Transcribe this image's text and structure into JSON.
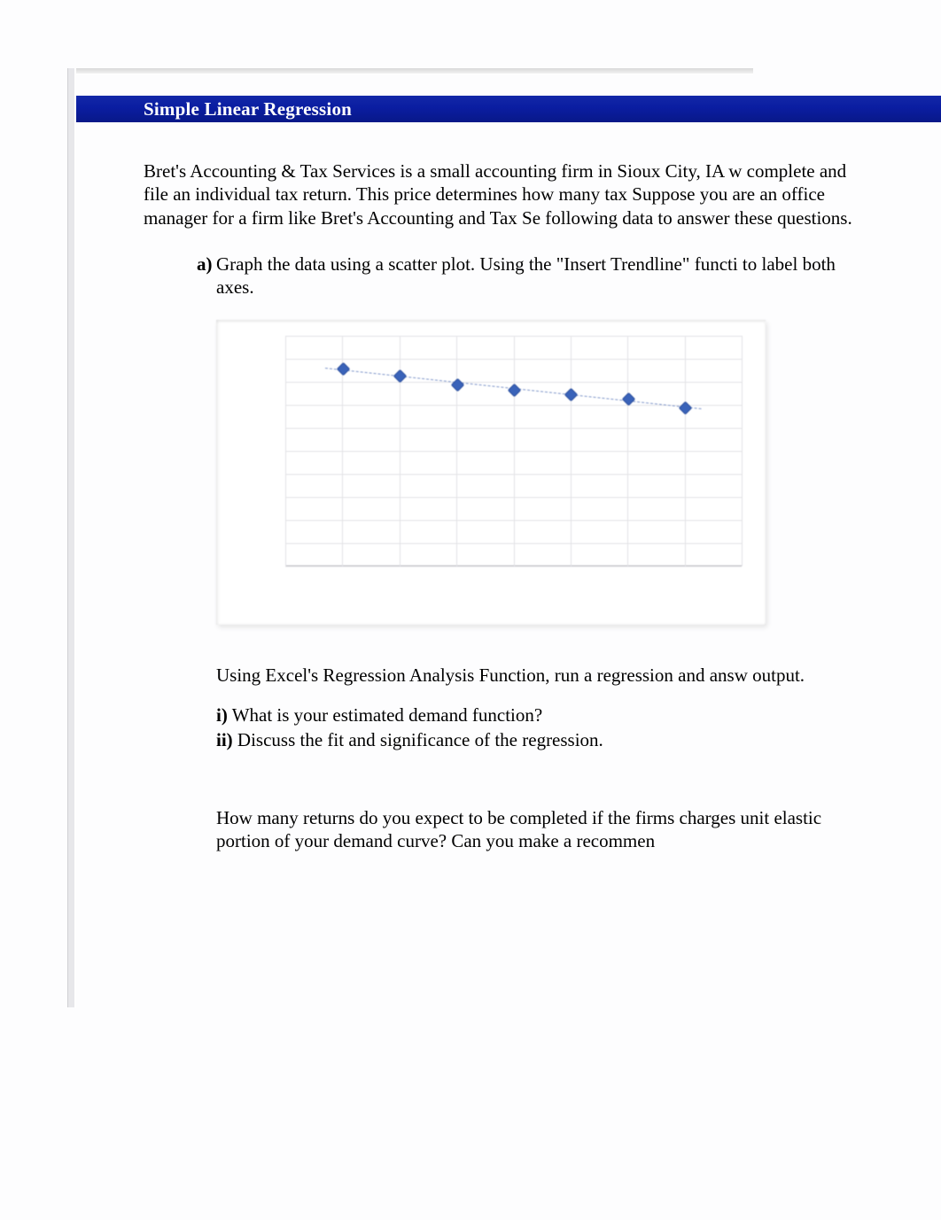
{
  "header": {
    "title": "Simple Linear Regression"
  },
  "intro": "Bret's Accounting & Tax Services is a small accounting firm in Sioux City, IA w complete and file an individual tax return. This price determines how many tax Suppose you are an office manager for a firm like Bret's Accounting and Tax Se following data to answer these questions.",
  "question_a": {
    "letter": "a)",
    "text": "Graph the data using a scatter plot. Using the \"Insert Trendline\" functi to label both axes."
  },
  "after_chart_text": "Using Excel's Regression Analysis Function, run a regression and answ output.",
  "sub_i": {
    "label": "i)",
    "text": " What is your estimated demand function?"
  },
  "sub_ii": {
    "label": "ii)",
    "text": " Discuss the fit and significance of the regression."
  },
  "para2": "How many returns do you expect to be completed if the firms charges unit elastic portion of your demand curve? Can you make a recommen",
  "chart_data": {
    "type": "scatter",
    "x": [
      1,
      2,
      3,
      4,
      5,
      6,
      7
    ],
    "y": [
      8.6,
      8.3,
      7.9,
      7.7,
      7.5,
      7.3,
      6.9
    ],
    "trendline": true,
    "xlim": [
      0,
      8
    ],
    "ylim": [
      0,
      10
    ],
    "x_gridlines": [
      0,
      1,
      2,
      3,
      4,
      5,
      6,
      7,
      8
    ],
    "y_gridlines": [
      0,
      1,
      2,
      3,
      4,
      5,
      6,
      7,
      8,
      9,
      10
    ]
  }
}
